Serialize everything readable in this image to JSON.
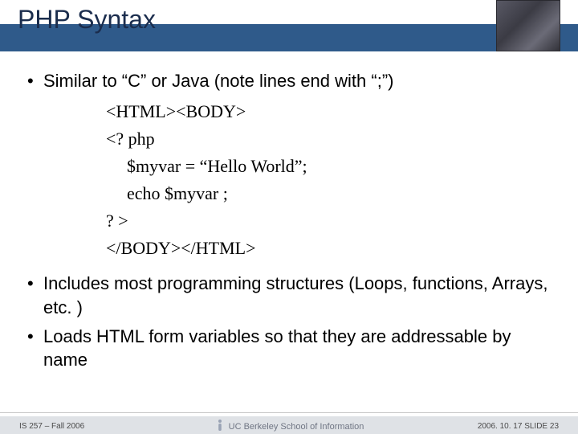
{
  "title": "PHP Syntax",
  "bullets": {
    "b1": "Similar to “C” or Java (note lines end with “;”)",
    "b2": "Includes most programming structures (Loops, functions, Arrays, etc. )",
    "b3": "Loads HTML form variables so that they are addressable by name"
  },
  "code": {
    "l1": "<HTML><BODY>",
    "l2": "<? php",
    "l3": "$myvar = “Hello World”;",
    "l4": "echo $myvar ;",
    "l5": "? >",
    "l6": "</BODY></HTML>"
  },
  "footer": {
    "left": "IS 257 – Fall 2006",
    "center": "UC Berkeley School of Information",
    "right": "2006. 10. 17 SLIDE 23"
  }
}
